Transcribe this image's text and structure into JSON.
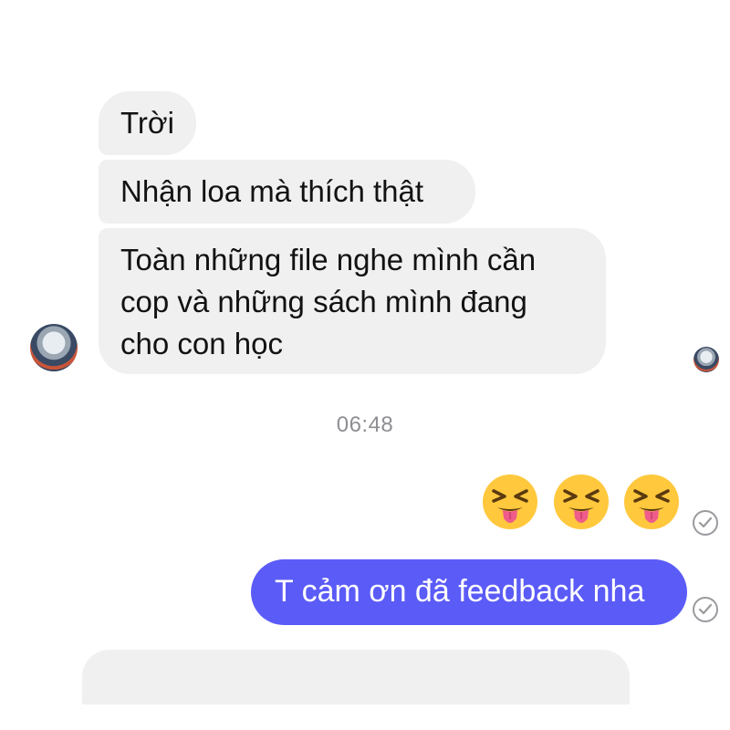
{
  "conversation": {
    "incoming": [
      {
        "text": "Trời"
      },
      {
        "text": "Nhận loa mà thích thật"
      },
      {
        "lines": [
          "Toàn những file nghe mình cần",
          "cop và những sách mình đang",
          "cho con học"
        ]
      }
    ],
    "timestamp": "06:48",
    "outgoing": {
      "emojis": [
        "squinting-face-with-tongue",
        "squinting-face-with-tongue",
        "squinting-face-with-tongue"
      ],
      "text": "T cảm ơn đã feedback nha"
    }
  },
  "colors": {
    "incoming_bubble": "#f0f0f1",
    "outgoing_bubble": "#5b5bf7",
    "timestamp": "#8e8e93",
    "read_check": "#9a9a9f"
  }
}
